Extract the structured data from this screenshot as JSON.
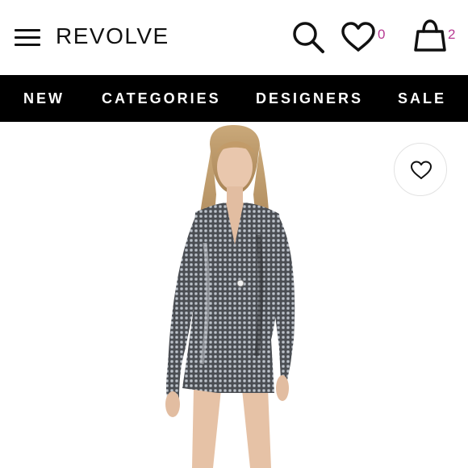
{
  "header": {
    "logo": "REVOLVE",
    "wishlist_count": "0",
    "bag_count": "2",
    "icons": [
      "hamburger-menu-icon",
      "search-icon",
      "heart-icon",
      "shopping-bag-icon"
    ],
    "accent_color": "#b73a93"
  },
  "nav": {
    "items": [
      {
        "label": "NEW"
      },
      {
        "label": "CATEGORIES"
      },
      {
        "label": "DESIGNERS"
      },
      {
        "label": "SALE"
      }
    ],
    "background": "#000000"
  },
  "product": {
    "favorite_icon": "heart-outline-icon",
    "image_description_icon": "product-photo"
  }
}
